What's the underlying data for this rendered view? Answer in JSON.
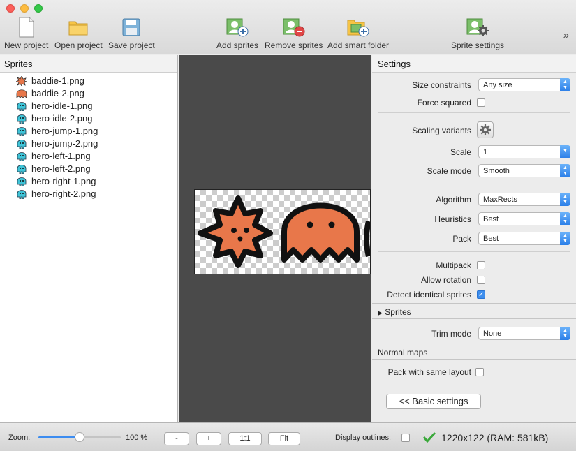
{
  "toolbar": {
    "new_project": "New project",
    "open_project": "Open project",
    "save_project": "Save project",
    "add_sprites": "Add sprites",
    "remove_sprites": "Remove sprites",
    "add_smart_folder": "Add smart folder",
    "sprite_settings": "Sprite settings",
    "more": "»"
  },
  "sprites_panel": {
    "title": "Sprites",
    "items": [
      {
        "name": "baddie-1.png",
        "icon": "baddie-star-icon"
      },
      {
        "name": "baddie-2.png",
        "icon": "baddie-ghost-icon"
      },
      {
        "name": "hero-idle-1.png",
        "icon": "hero-icon"
      },
      {
        "name": "hero-idle-2.png",
        "icon": "hero-icon"
      },
      {
        "name": "hero-jump-1.png",
        "icon": "hero-icon"
      },
      {
        "name": "hero-jump-2.png",
        "icon": "hero-icon"
      },
      {
        "name": "hero-left-1.png",
        "icon": "hero-icon"
      },
      {
        "name": "hero-left-2.png",
        "icon": "hero-icon"
      },
      {
        "name": "hero-right-1.png",
        "icon": "hero-icon"
      },
      {
        "name": "hero-right-2.png",
        "icon": "hero-icon"
      }
    ]
  },
  "settings": {
    "title": "Settings",
    "size_constraints": {
      "label": "Size constraints",
      "value": "Any size"
    },
    "force_squared": {
      "label": "Force squared",
      "checked": false
    },
    "scaling_variants": {
      "label": "Scaling variants"
    },
    "scale": {
      "label": "Scale",
      "value": "1"
    },
    "scale_mode": {
      "label": "Scale mode",
      "value": "Smooth"
    },
    "algorithm": {
      "label": "Algorithm",
      "value": "MaxRects"
    },
    "heuristics": {
      "label": "Heuristics",
      "value": "Best"
    },
    "pack": {
      "label": "Pack",
      "value": "Best"
    },
    "multipack": {
      "label": "Multipack",
      "checked": false
    },
    "allow_rotation": {
      "label": "Allow rotation",
      "checked": false
    },
    "detect_identical": {
      "label": "Detect identical sprites",
      "checked": true
    },
    "sprites_section": "Sprites",
    "trim_mode": {
      "label": "Trim mode",
      "value": "None"
    },
    "normal_maps": "Normal maps",
    "pack_same_layout": {
      "label": "Pack with same layout",
      "checked": false
    },
    "basic_settings_button": "<< Basic settings"
  },
  "status": {
    "zoom_label": "Zoom:",
    "zoom_value": "100 %",
    "zoom_fraction": 0.5,
    "minus": "-",
    "plus": "+",
    "one_to_one": "1:1",
    "fit": "Fit",
    "display_outlines_label": "Display outlines:",
    "sheet_info": "1220x122 (RAM: 581kB)"
  },
  "colors": {
    "sprite_orange": "#e8774a",
    "hero_cyan": "#3fc4d8",
    "accent_blue": "#3c8cf0",
    "ok_green": "#3aa83a"
  }
}
